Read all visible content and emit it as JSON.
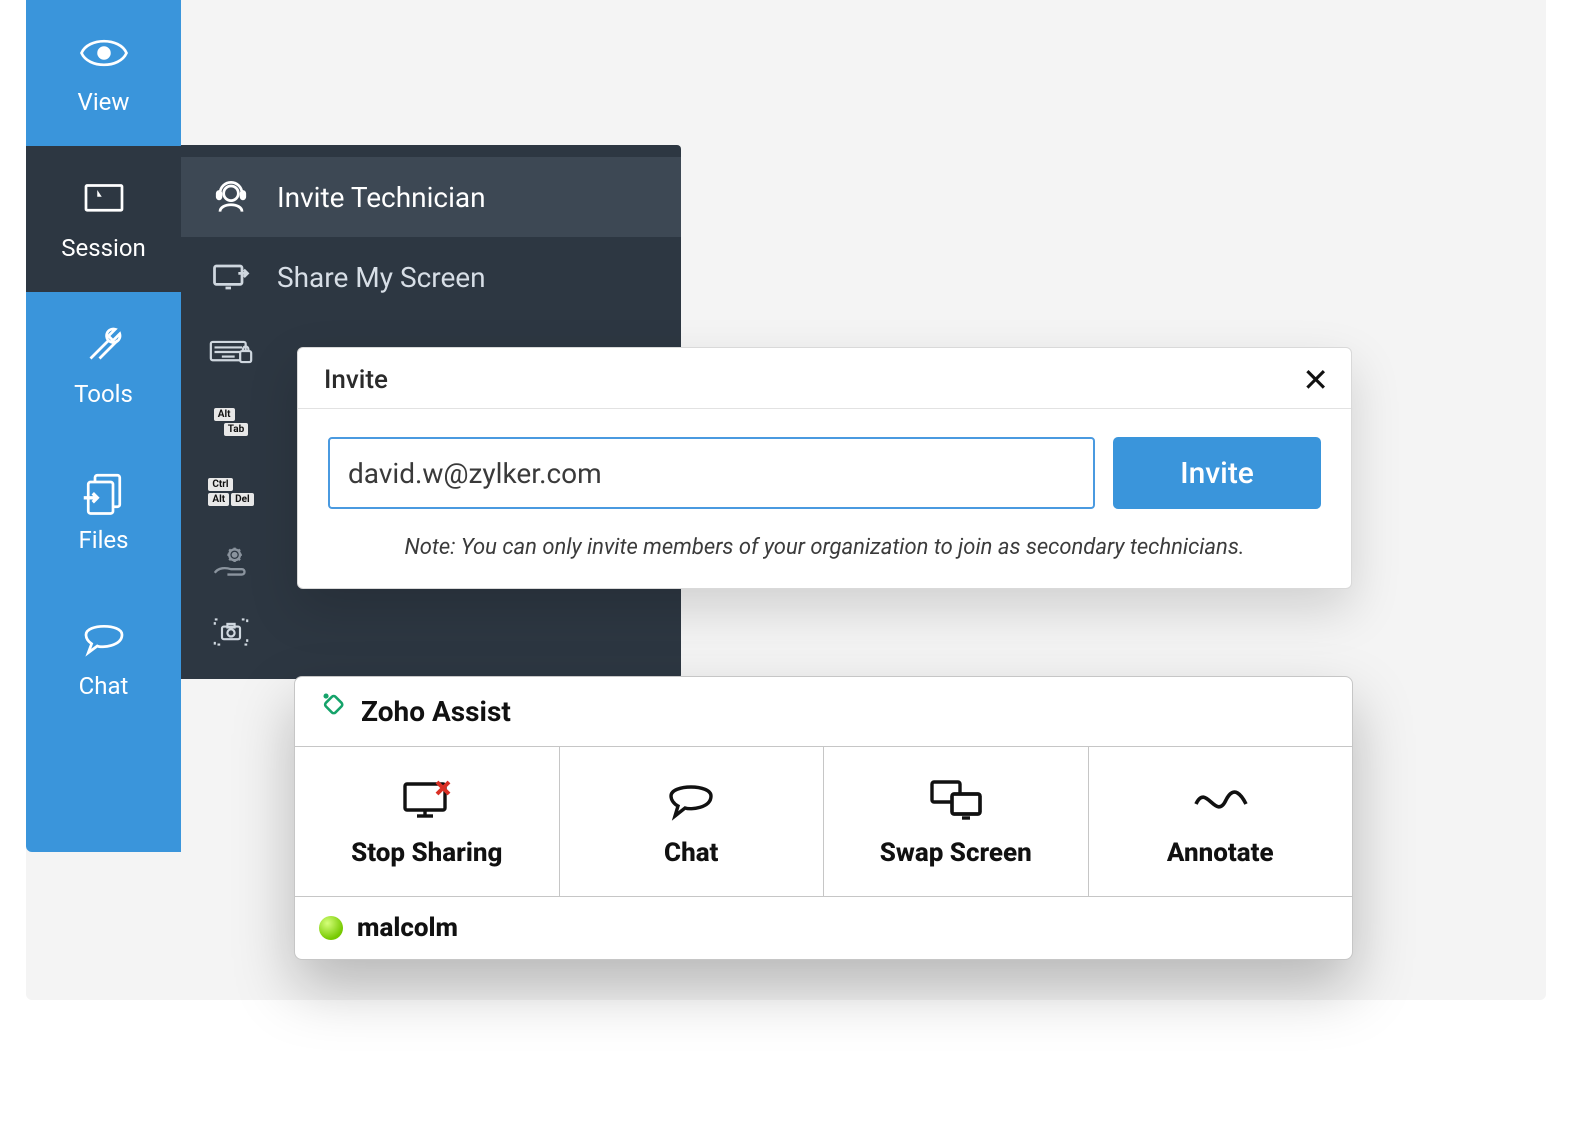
{
  "sidebar": {
    "items": [
      {
        "label": "View"
      },
      {
        "label": "Session"
      },
      {
        "label": "Tools"
      },
      {
        "label": "Files"
      },
      {
        "label": "Chat"
      }
    ]
  },
  "submenu": {
    "items": [
      {
        "label": "Invite Technician"
      },
      {
        "label": "Share My Screen"
      }
    ],
    "keycaps": {
      "alttab": [
        "Alt",
        "Tab"
      ],
      "ctrlaltdel": [
        "Ctrl",
        "Alt",
        "Del"
      ]
    }
  },
  "invite": {
    "title": "Invite",
    "email_value": "david.w@zylker.com",
    "button_label": "Invite",
    "note": "Note: You can only invite members of your organization to join as secondary technicians."
  },
  "assist": {
    "title": "Zoho Assist",
    "actions": [
      {
        "label": "Stop Sharing"
      },
      {
        "label": "Chat"
      },
      {
        "label": "Swap Screen"
      },
      {
        "label": "Annotate"
      }
    ],
    "user": "malcolm"
  }
}
